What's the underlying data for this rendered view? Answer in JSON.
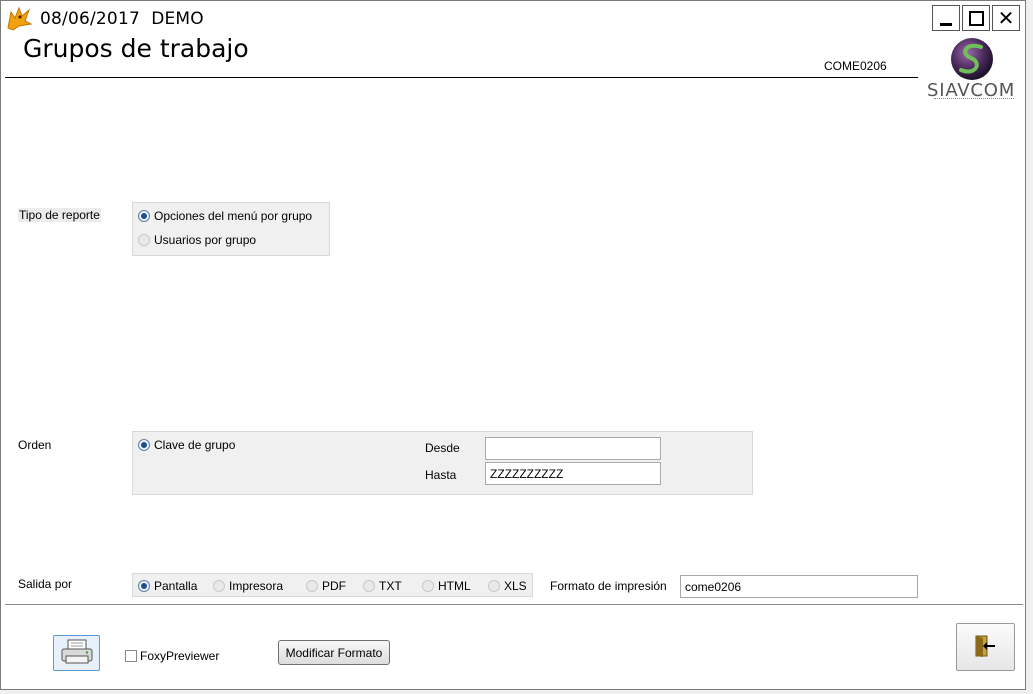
{
  "window": {
    "title": "08/06/2017  DEMO",
    "icon": "fox-icon",
    "controls": {
      "minimize": "minimize-icon",
      "maximize": "maximize-icon",
      "close": "close-icon"
    }
  },
  "header": {
    "title": "Grupos de trabajo",
    "form_code": "COME0206",
    "logo_text": "SIAVCOM"
  },
  "report_type": {
    "label": "Tipo de reporte",
    "options": [
      {
        "label": "Opciones del menú por grupo",
        "selected": true
      },
      {
        "label": "Usuarios por grupo",
        "selected": false
      }
    ]
  },
  "order": {
    "label": "Orden",
    "options": [
      {
        "label": "Clave de grupo",
        "selected": true
      }
    ],
    "from_label": "Desde",
    "from_value": "",
    "to_label": "Hasta",
    "to_value": "ZZZZZZZZZZ"
  },
  "output": {
    "label": "Salida por",
    "options": [
      {
        "label": "Pantalla",
        "selected": true
      },
      {
        "label": "Impresora",
        "selected": false
      },
      {
        "label": "PDF",
        "selected": false
      },
      {
        "label": "TXT",
        "selected": false
      },
      {
        "label": "HTML",
        "selected": false
      },
      {
        "label": "XLS",
        "selected": false
      }
    ],
    "format_label": "Formato de impresión",
    "format_value": "come0206"
  },
  "footer": {
    "print_icon": "printer-icon",
    "foxy_label": "FoxyPreviewer",
    "foxy_checked": false,
    "modify_label": "Modificar Formato",
    "exit_icon": "exit-door-icon"
  },
  "colors": {
    "radio_selected": "#1f4f8f",
    "panel_bg": "#f0f0f0",
    "print_button_border": "#5a9ad8"
  }
}
